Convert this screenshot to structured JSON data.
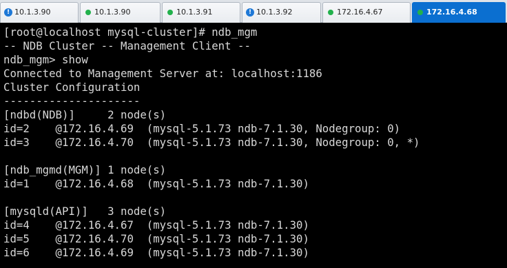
{
  "tabs": [
    {
      "label": "10.1.3.90",
      "status": "warning",
      "status_color": "#1e78d6",
      "active": false
    },
    {
      "label": "10.1.3.90",
      "status": "connected",
      "status_color": "#22b14c",
      "active": false
    },
    {
      "label": "10.1.3.91",
      "status": "connected",
      "status_color": "#22b14c",
      "active": false
    },
    {
      "label": "10.1.3.92",
      "status": "warning",
      "status_color": "#1e78d6",
      "active": false
    },
    {
      "label": "172.16.4.67",
      "status": "connected",
      "status_color": "#22b14c",
      "active": false
    },
    {
      "label": "172.16.4.68",
      "status": "connected",
      "status_color": "#22b14c",
      "active": true
    }
  ],
  "warning_glyph": "!",
  "terminal": {
    "lines": [
      "[root@localhost mysql-cluster]# ndb_mgm",
      "-- NDB Cluster -- Management Client --",
      "ndb_mgm> show",
      "Connected to Management Server at: localhost:1186",
      "Cluster Configuration",
      "---------------------",
      "[ndbd(NDB)]     2 node(s)",
      "id=2    @172.16.4.69  (mysql-5.1.73 ndb-7.1.30, Nodegroup: 0)",
      "id=3    @172.16.4.70  (mysql-5.1.73 ndb-7.1.30, Nodegroup: 0, *)",
      "",
      "[ndb_mgmd(MGM)] 1 node(s)",
      "id=1    @172.16.4.68  (mysql-5.1.73 ndb-7.1.30)",
      "",
      "[mysqld(API)]   3 node(s)",
      "id=4    @172.16.4.67  (mysql-5.1.73 ndb-7.1.30)",
      "id=5    @172.16.4.70  (mysql-5.1.73 ndb-7.1.30)",
      "id=6    @172.16.4.69  (mysql-5.1.73 ndb-7.1.30)"
    ]
  },
  "colors": {
    "terminal_bg": "#000000",
    "terminal_fg": "#d8d8d8",
    "active_tab": "#0b6fd0"
  }
}
